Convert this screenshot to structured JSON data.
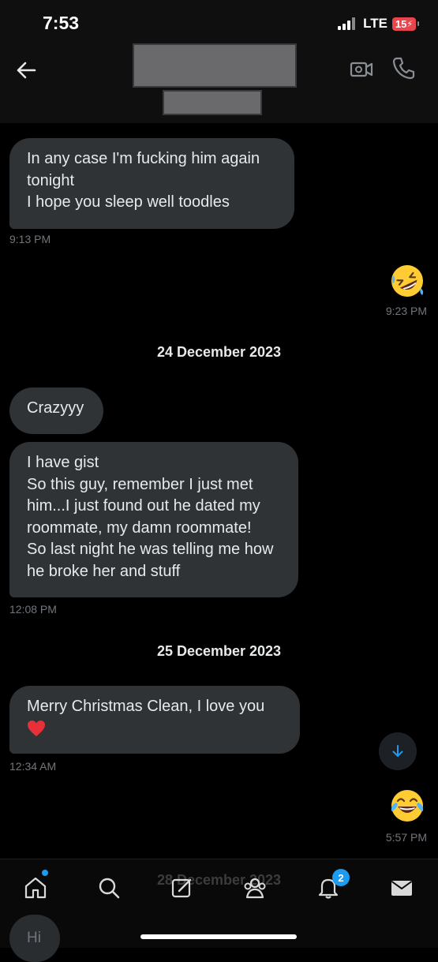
{
  "status_bar": {
    "time": "7:53",
    "network": "LTE",
    "battery": "15"
  },
  "messages": [
    {
      "text": "In any case I'm fucking him again tonight\nI hope you sleep well toodles",
      "time": "9:13 PM"
    },
    {
      "emoji": "rolling-on-floor-laughing",
      "time": "9:23 PM"
    },
    {
      "date": "24 December 2023"
    },
    {
      "text": "Crazyyy"
    },
    {
      "text": "I have gist\nSo this guy, remember I just met him...I just found out he dated my roommate, my damn roommate!\nSo last night he was telling me how he broke her and stuff",
      "time": "12:08 PM"
    },
    {
      "date": "25 December 2023"
    },
    {
      "text": "Merry Christmas Clean, I love you",
      "emoji": "red-heart",
      "time": "12:34 AM"
    },
    {
      "emoji": "face-with-tears-of-joy",
      "time": "5:57 PM"
    },
    {
      "date": "28 December 2023"
    }
  ],
  "bottom_nav": {
    "notifications_badge": "2"
  },
  "composer": {
    "placeholder": "Hi"
  },
  "colors": {
    "bubble_in": "#2f3336",
    "accent": "#1d9bf0",
    "background": "#000000",
    "timestamp": "#71767b"
  }
}
